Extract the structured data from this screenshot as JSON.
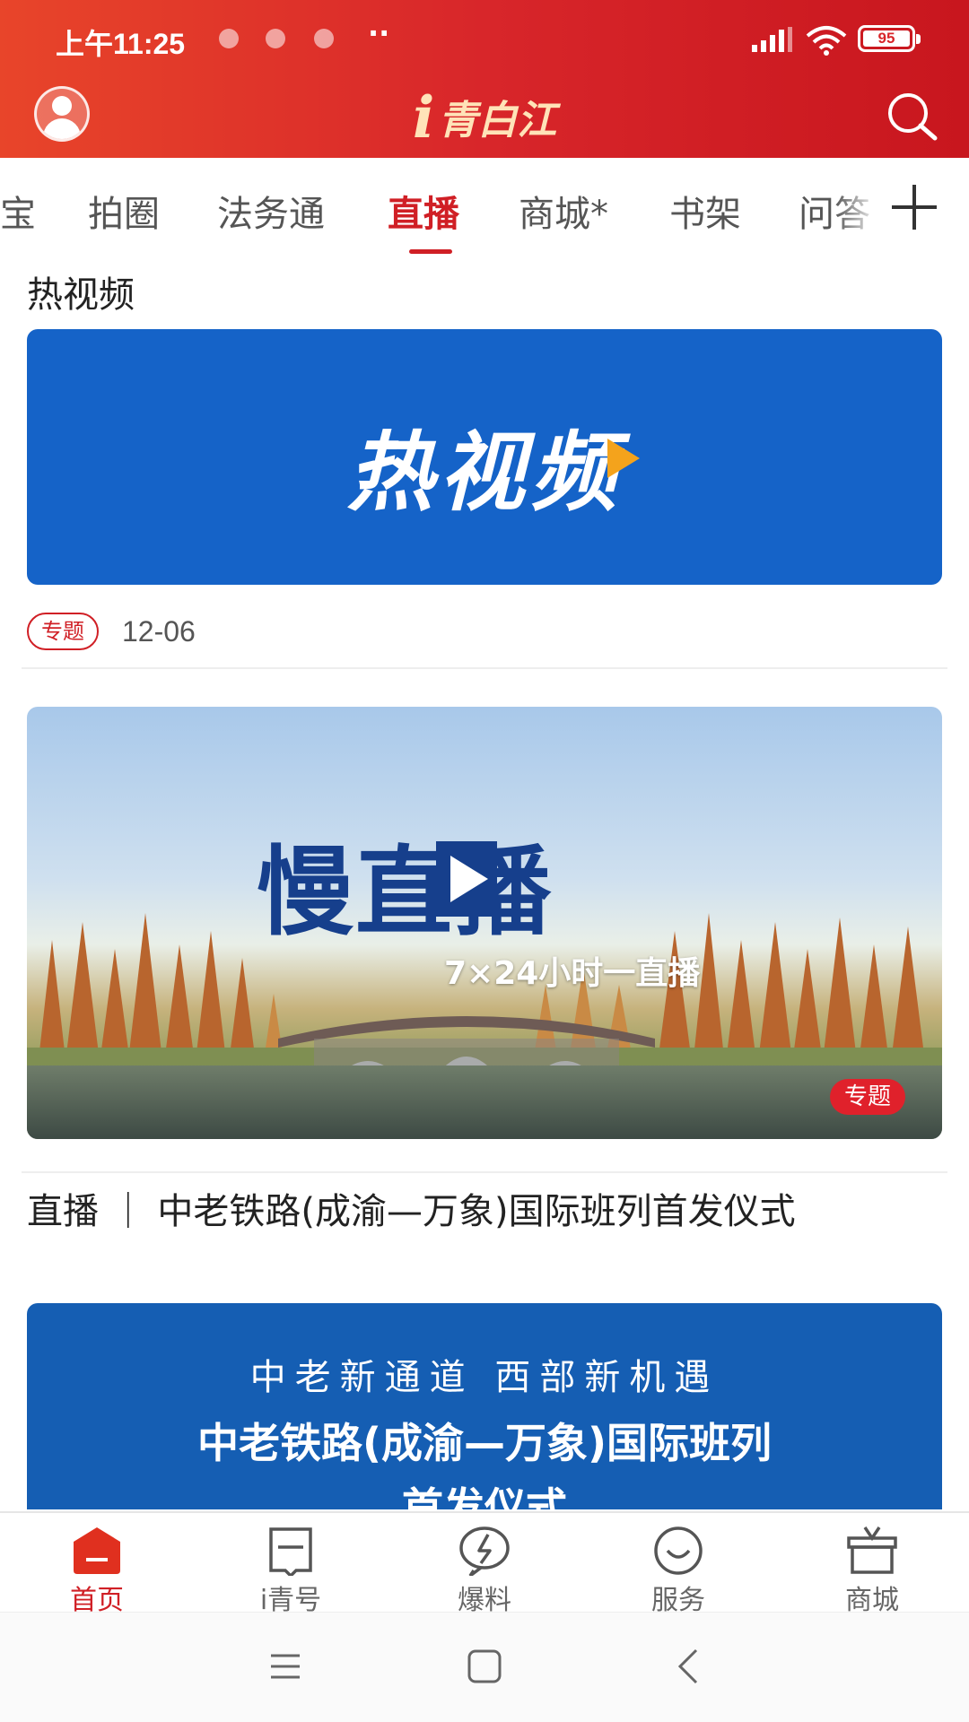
{
  "status_bar": {
    "time": "上午11:25",
    "dots": "··",
    "battery": "95"
  },
  "header": {
    "logo_i": "i",
    "logo_text": "青白江",
    "brand_color": "#d8262a"
  },
  "tabs": [
    {
      "label": "宝"
    },
    {
      "label": "拍圈"
    },
    {
      "label": "法务通"
    },
    {
      "label": "直播",
      "active": true
    },
    {
      "label": "商城*"
    },
    {
      "label": "书架"
    },
    {
      "label": "问答"
    }
  ],
  "section": {
    "title": "热视频"
  },
  "hot_video_banner": {
    "text": "热视频"
  },
  "hot_video_meta": {
    "tag": "专题",
    "date": "12-06"
  },
  "slow_live_banner": {
    "title": "慢直播",
    "subtitle": "7×24小时一直播",
    "tag": "专题"
  },
  "article": {
    "title": "直播 ｜ 中老铁路(成渝—万象)国际班列首发仪式"
  },
  "rail_banner": {
    "line1": "中老新通道  西部新机遇",
    "line2": "中老铁路(成渝—万象)国际班列",
    "line3": "首发仪式"
  },
  "bottom_nav": [
    {
      "label": "首页",
      "icon": "home-icon",
      "active": true
    },
    {
      "label": "i青号",
      "icon": "message-icon"
    },
    {
      "label": "爆料",
      "icon": "lightning-icon"
    },
    {
      "label": "服务",
      "icon": "smile-icon"
    },
    {
      "label": "商城",
      "icon": "gift-box-icon"
    }
  ],
  "system_nav": {
    "icons": [
      "menu-icon",
      "home-square-icon",
      "back-icon"
    ]
  }
}
